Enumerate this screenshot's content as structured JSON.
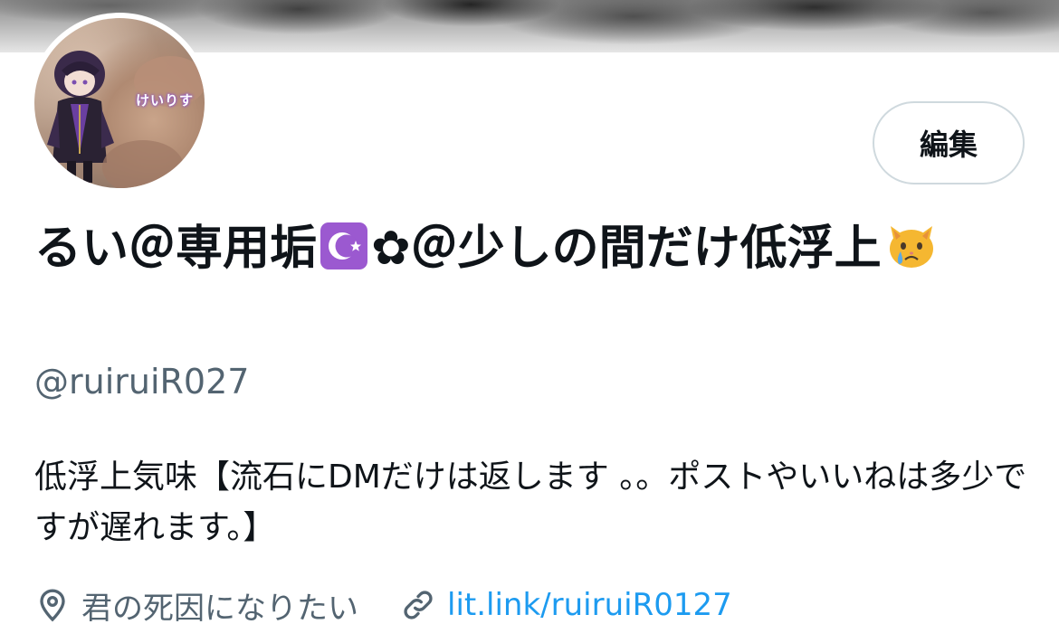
{
  "banner": {
    "description_colors": [
      "#8a8a8a",
      "#e6e6e6"
    ]
  },
  "avatar": {
    "overlay_text": "けいりす"
  },
  "actions": {
    "edit_label": "編集"
  },
  "profile": {
    "name_part1": "るい＠専用垢",
    "name_icon1": "star-and-crescent-emoji",
    "name_part2": "✿＠少しの間だけ低浮上",
    "name_icon2": "crying-cat-emoji",
    "handle": "@ruiruiR027",
    "bio": "低浮上気味【流石にDMだけは返します 。。ポストやいいねは多少ですが遅れます。】",
    "location_icon": "location-pin-icon",
    "location": "君の死因になりたい",
    "link_icon": "link-icon",
    "link": "lit.link/ruiruiR0127"
  },
  "colors": {
    "text_primary": "#0f1419",
    "text_secondary": "#536471",
    "link": "#1d9bf0",
    "button_border": "#cfd9de"
  }
}
